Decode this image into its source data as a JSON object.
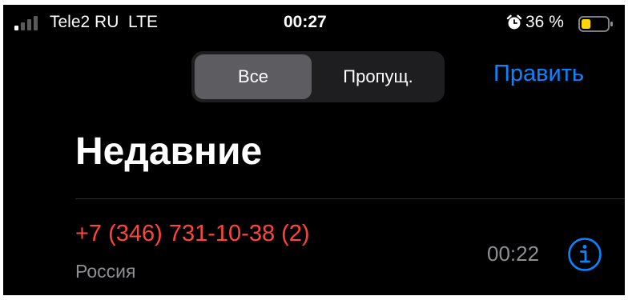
{
  "status_bar": {
    "carrier": "Tele2 RU  LTE",
    "time": "00:27",
    "battery_percent": "36 %",
    "icons": [
      "signal-icon",
      "alarm-icon",
      "battery-icon"
    ],
    "battery_level": 0.36
  },
  "segmented_control": {
    "segments": [
      "Все",
      "Пропущ."
    ],
    "selected": "Все"
  },
  "header": {
    "edit_label": "Править",
    "title": "Недавние"
  },
  "calls": [
    {
      "number": "+7 (346) 731-10-38 (2)",
      "location": "Россия",
      "time": "00:22",
      "missed": true
    }
  ],
  "colors": {
    "background": "#000000",
    "accent": "#0a84ff",
    "missed": "#ff453a",
    "secondary_text": "#8e8e93",
    "segment_selected": "#5c5c61",
    "segment_track": "#1e1e20",
    "battery_low": "#ffd60a"
  }
}
